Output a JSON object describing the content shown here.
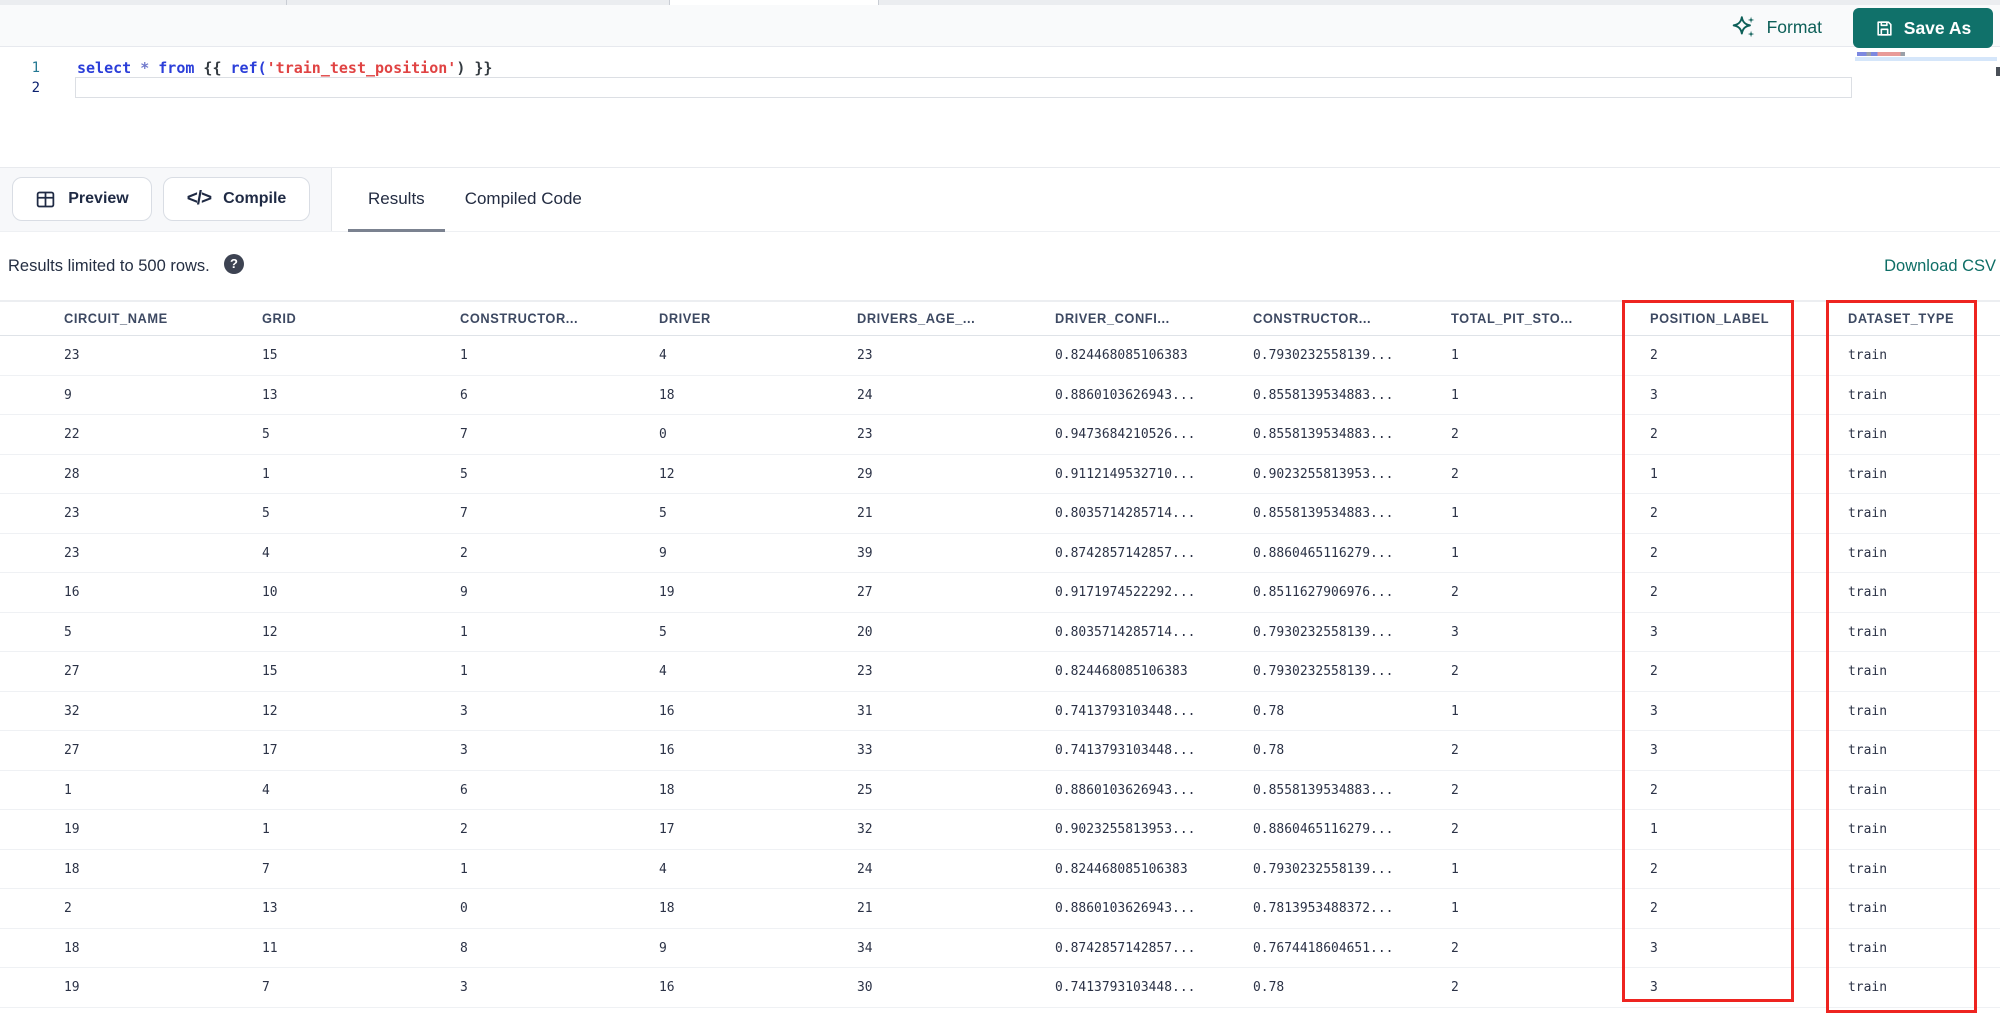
{
  "colors": {
    "accent_teal": "#10716a",
    "link_teal": "#0e6e66",
    "highlight_red": "#ee2420"
  },
  "icons": {
    "format": "sparkles-icon",
    "save_as": "save-icon",
    "preview": "table-icon",
    "compile": "code-icon",
    "help": "help-circle-icon"
  },
  "toolbar": {
    "format_label": "Format",
    "save_as_label": "Save As"
  },
  "editor": {
    "lines": [
      {
        "number": "1",
        "tokens": [
          {
            "text": "select",
            "type": "keyword"
          },
          {
            "text": " ",
            "type": "plain"
          },
          {
            "text": "*",
            "type": "operator"
          },
          {
            "text": " ",
            "type": "plain"
          },
          {
            "text": "from",
            "type": "keyword"
          },
          {
            "text": " {{ ",
            "type": "plain"
          },
          {
            "text": "ref(",
            "type": "function"
          },
          {
            "text": "'train_test_position'",
            "type": "string"
          },
          {
            "text": ") }}",
            "type": "plain"
          }
        ]
      },
      {
        "number": "2",
        "tokens": []
      }
    ]
  },
  "actions": {
    "preview_label": "Preview",
    "compile_label": "Compile",
    "compile_glyph": "</>"
  },
  "tabs": [
    {
      "label": "Results",
      "active": true
    },
    {
      "label": "Compiled Code",
      "active": false
    }
  ],
  "results_bar": {
    "info": "Results limited to 500 rows.",
    "help_glyph": "?",
    "download_label": "Download CSV"
  },
  "table": {
    "columns": [
      "CIRCUIT_NAME",
      "GRID",
      "CONSTRUCTOR...",
      "DRIVER",
      "DRIVERS_AGE_...",
      "DRIVER_CONFI...",
      "CONSTRUCTOR...",
      "TOTAL_PIT_STO...",
      "POSITION_LABEL",
      "DATASET_TYPE"
    ],
    "rows": [
      [
        "23",
        "15",
        "1",
        "4",
        "23",
        "0.824468085106383",
        "0.7930232558139...",
        "1",
        "2",
        "train"
      ],
      [
        "9",
        "13",
        "6",
        "18",
        "24",
        "0.8860103626943...",
        "0.8558139534883...",
        "1",
        "3",
        "train"
      ],
      [
        "22",
        "5",
        "7",
        "0",
        "23",
        "0.9473684210526...",
        "0.8558139534883...",
        "2",
        "2",
        "train"
      ],
      [
        "28",
        "1",
        "5",
        "12",
        "29",
        "0.9112149532710...",
        "0.9023255813953...",
        "2",
        "1",
        "train"
      ],
      [
        "23",
        "5",
        "7",
        "5",
        "21",
        "0.8035714285714...",
        "0.8558139534883...",
        "1",
        "2",
        "train"
      ],
      [
        "23",
        "4",
        "2",
        "9",
        "39",
        "0.8742857142857...",
        "0.8860465116279...",
        "1",
        "2",
        "train"
      ],
      [
        "16",
        "10",
        "9",
        "19",
        "27",
        "0.9171974522292...",
        "0.8511627906976...",
        "2",
        "2",
        "train"
      ],
      [
        "5",
        "12",
        "1",
        "5",
        "20",
        "0.8035714285714...",
        "0.7930232558139...",
        "3",
        "3",
        "train"
      ],
      [
        "27",
        "15",
        "1",
        "4",
        "23",
        "0.824468085106383",
        "0.7930232558139...",
        "2",
        "2",
        "train"
      ],
      [
        "32",
        "12",
        "3",
        "16",
        "31",
        "0.7413793103448...",
        "0.78",
        "1",
        "3",
        "train"
      ],
      [
        "27",
        "17",
        "3",
        "16",
        "33",
        "0.7413793103448...",
        "0.78",
        "2",
        "3",
        "train"
      ],
      [
        "1",
        "4",
        "6",
        "18",
        "25",
        "0.8860103626943...",
        "0.8558139534883...",
        "2",
        "2",
        "train"
      ],
      [
        "19",
        "1",
        "2",
        "17",
        "32",
        "0.9023255813953...",
        "0.8860465116279...",
        "2",
        "1",
        "train"
      ],
      [
        "18",
        "7",
        "1",
        "4",
        "24",
        "0.824468085106383",
        "0.7930232558139...",
        "1",
        "2",
        "train"
      ],
      [
        "2",
        "13",
        "0",
        "18",
        "21",
        "0.8860103626943...",
        "0.7813953488372...",
        "1",
        "2",
        "train"
      ],
      [
        "18",
        "11",
        "8",
        "9",
        "34",
        "0.8742857142857...",
        "0.7674418604651...",
        "2",
        "3",
        "train"
      ],
      [
        "19",
        "7",
        "3",
        "16",
        "30",
        "0.7413793103448...",
        "0.78",
        "2",
        "3",
        "train"
      ]
    ]
  }
}
